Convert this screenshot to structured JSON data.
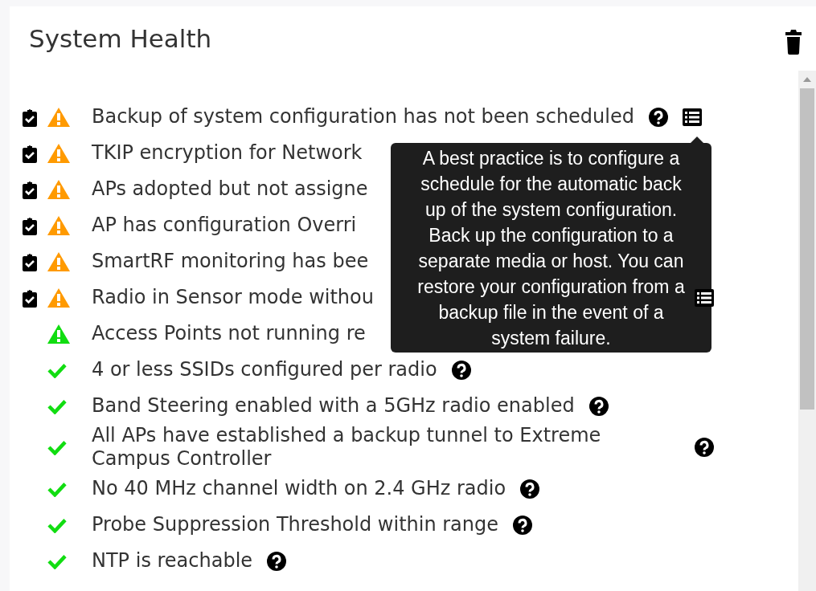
{
  "panel": {
    "title": "System Health"
  },
  "items": [
    {
      "clipboard": true,
      "kind": "warning",
      "color": "#ff9a00",
      "text": "Backup of system configuration has not been scheduled",
      "help": true,
      "details": true
    },
    {
      "clipboard": true,
      "kind": "warning",
      "color": "#ff9a00",
      "text": "TKIP encryption for Network",
      "help": false,
      "details": false
    },
    {
      "clipboard": true,
      "kind": "warning",
      "color": "#ff9a00",
      "text": "APs adopted but not assigne",
      "help": false,
      "details": false
    },
    {
      "clipboard": true,
      "kind": "warning",
      "color": "#ff9a00",
      "text": "AP has configuration Overri",
      "help": false,
      "details": false
    },
    {
      "clipboard": true,
      "kind": "warning",
      "color": "#ff9a00",
      "text": "SmartRF monitoring has bee",
      "help": false,
      "details": false
    },
    {
      "clipboard": true,
      "kind": "warning",
      "color": "#ff9a00",
      "text": "Radio in Sensor mode withou",
      "help": false,
      "details": true
    },
    {
      "clipboard": false,
      "kind": "warning",
      "color": "#11dd11",
      "text": "Access Points not running re",
      "help": false,
      "details": false
    },
    {
      "clipboard": false,
      "kind": "ok",
      "color": "#11dd11",
      "text": "4 or less SSIDs configured per radio",
      "help": true,
      "details": false
    },
    {
      "clipboard": false,
      "kind": "ok",
      "color": "#11dd11",
      "text": "Band Steering enabled with a 5GHz radio enabled",
      "help": true,
      "details": false
    },
    {
      "clipboard": false,
      "kind": "ok",
      "color": "#11dd11",
      "text": "All APs have established a backup tunnel to Extreme Campus Controller",
      "help": true,
      "details": false
    },
    {
      "clipboard": false,
      "kind": "ok",
      "color": "#11dd11",
      "text": "No 40 MHz channel width on 2.4 GHz radio",
      "help": true,
      "details": false
    },
    {
      "clipboard": false,
      "kind": "ok",
      "color": "#11dd11",
      "text": "Probe Suppression Threshold within range",
      "help": true,
      "details": false
    },
    {
      "clipboard": false,
      "kind": "ok",
      "color": "#11dd11",
      "text": "NTP is reachable",
      "help": true,
      "details": false
    }
  ],
  "tooltip": {
    "text": "A best practice is to configure a schedule for the automatic back up of the system configuration. Back up the configuration to a separate media or host. You can restore your configuration from a backup file in the event of a system failure."
  }
}
